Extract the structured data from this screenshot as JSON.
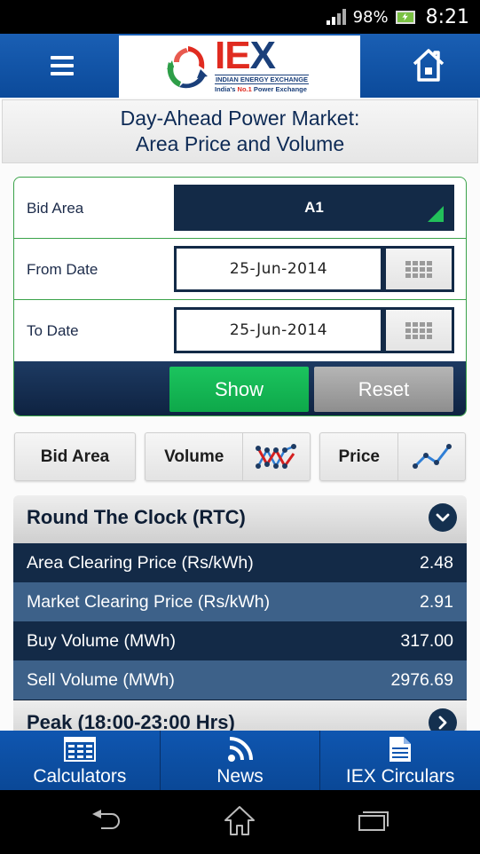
{
  "status_bar": {
    "battery_percent": "98%",
    "time": "8:21"
  },
  "header": {
    "logo": {
      "brand": "IEX",
      "brand_letters": [
        "I",
        "E",
        "X"
      ],
      "tagline_1": "INDIAN ENERGY EXCHANGE",
      "tagline_2_prefix": "India's ",
      "tagline_2_highlight": "No.1",
      "tagline_2_suffix": " Power Exchange"
    },
    "menu_icon": "hamburger-menu-icon",
    "home_icon": "home-icon"
  },
  "page_title": {
    "line1": "Day-Ahead Power Market:",
    "line2": "Area Price and Volume"
  },
  "form": {
    "bid_area": {
      "label": "Bid Area",
      "value": "A1"
    },
    "from_date": {
      "label": "From Date",
      "value": "25-Jun-2014"
    },
    "to_date": {
      "label": "To Date",
      "value": "25-Jun-2014"
    },
    "show_label": "Show",
    "reset_label": "Reset"
  },
  "view_tabs": {
    "bid_area": "Bid Area",
    "volume": "Volume",
    "price": "Price"
  },
  "results": {
    "rtc": {
      "title": "Round The Clock (RTC)",
      "rows": [
        {
          "label": "Area Clearing Price (Rs/kWh)",
          "value": "2.48"
        },
        {
          "label": "Market Clearing Price (Rs/kWh)",
          "value": "2.91"
        },
        {
          "label": "Buy Volume (MWh)",
          "value": "317.00"
        },
        {
          "label": "Sell Volume (MWh)",
          "value": "2976.69"
        }
      ]
    },
    "peak": {
      "title": "Peak (18:00-23:00 Hrs)"
    }
  },
  "bottom_nav": {
    "items": [
      {
        "label": "Calculators",
        "icon": "calculator-icon"
      },
      {
        "label": "News",
        "icon": "rss-icon"
      },
      {
        "label": "IEX Circulars",
        "icon": "document-icon"
      }
    ]
  },
  "colors": {
    "header_blue": "#0b4a9a",
    "navy": "#132a47",
    "row_light": "#3d6189",
    "show_green": "#0ea84a",
    "form_border_green": "#3aa349",
    "logo_red": "#e02b20"
  }
}
